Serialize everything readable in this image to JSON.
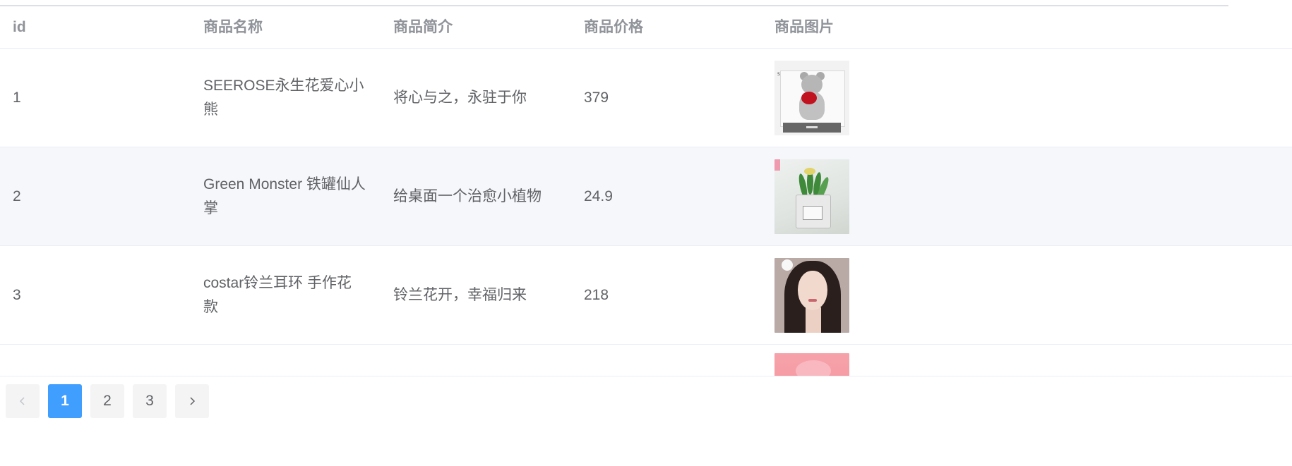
{
  "table": {
    "columns": [
      "id",
      "商品名称",
      "商品简介",
      "商品价格",
      "商品图片"
    ],
    "rows": [
      {
        "id": "1",
        "name": "SEEROSE永生花爱心小熊",
        "desc": "将心与之，永驻于你",
        "price": "379",
        "image": "teddy-bear-rose-photo",
        "brand": "SEEROSE"
      },
      {
        "id": "2",
        "name": "Green Monster 铁罐仙人掌",
        "desc": "给桌面一个治愈小植物",
        "price": "24.9",
        "image": "cactus-tin-photo"
      },
      {
        "id": "3",
        "name": "costar铃兰耳环 手作花款",
        "desc": "铃兰花开，幸福归来",
        "price": "218",
        "image": "portrait-earring-photo"
      },
      {
        "id": "",
        "name": "",
        "desc": "",
        "price": "",
        "image": "pink-box-photo"
      }
    ]
  },
  "pagination": {
    "prev_icon": "chevron-left-icon",
    "pages": [
      "1",
      "2",
      "3"
    ],
    "current": "1",
    "next_icon": "chevron-right-icon"
  },
  "colors": {
    "accent": "#409eff",
    "header_text": "#909399",
    "body_text": "#606266",
    "stripe": "#f5f7fa",
    "border": "#ebeef5"
  }
}
